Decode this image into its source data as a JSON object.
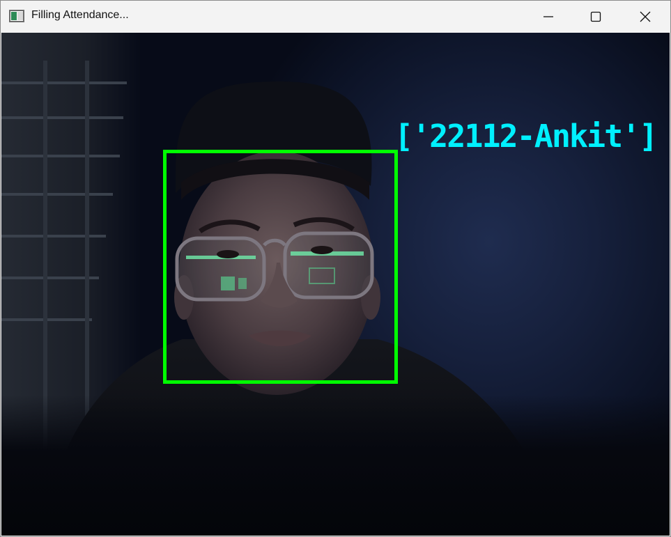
{
  "window": {
    "title": "Filling Attendance...",
    "controls": {
      "minimize": "minimize",
      "maximize": "maximize",
      "close": "close"
    }
  },
  "camera_view": {
    "detected_label": "['22112-Ankit']",
    "label_color": "#00f0ff",
    "box_color": "#00ff00"
  }
}
